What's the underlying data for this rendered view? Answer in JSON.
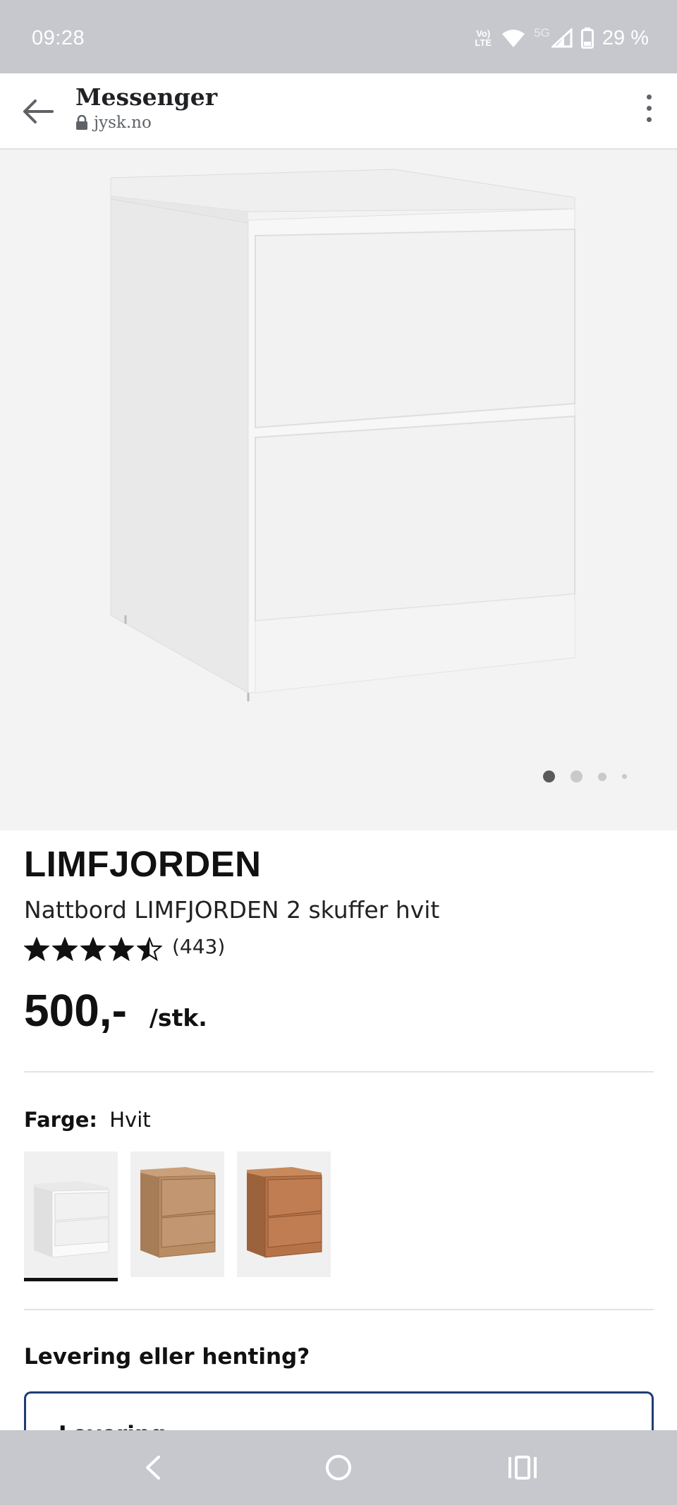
{
  "status_bar": {
    "time": "09:28",
    "volte": "Vo LTE",
    "network": "5G",
    "battery": "29 %"
  },
  "browser": {
    "app_title": "Messenger",
    "url": "jysk.no"
  },
  "gallery": {
    "image_alt": "Nattbord LIMFJORDEN 2 skuffer hvit",
    "slide_count": 4,
    "active_slide": 1
  },
  "product": {
    "brand": "LIMFJORDEN",
    "name": "Nattbord LIMFJORDEN 2 skuffer hvit",
    "rating": 4.5,
    "rating_max": 5,
    "review_count": "(443)",
    "price": "500,-",
    "unit": "/stk."
  },
  "color": {
    "label": "Farge:",
    "value": "Hvit",
    "options": [
      {
        "name": "white",
        "selected": true
      },
      {
        "name": "oak",
        "selected": false
      },
      {
        "name": "dark-oak",
        "selected": false
      }
    ]
  },
  "delivery": {
    "title": "Levering eller henting?",
    "option_label": "Levering"
  },
  "colors": {
    "status_bar_bg": "#c6c8cd",
    "nav_bar_bg": "#c6c8cd",
    "gallery_bg": "#f3f3f3",
    "delivery_border": "#1f3c73"
  }
}
